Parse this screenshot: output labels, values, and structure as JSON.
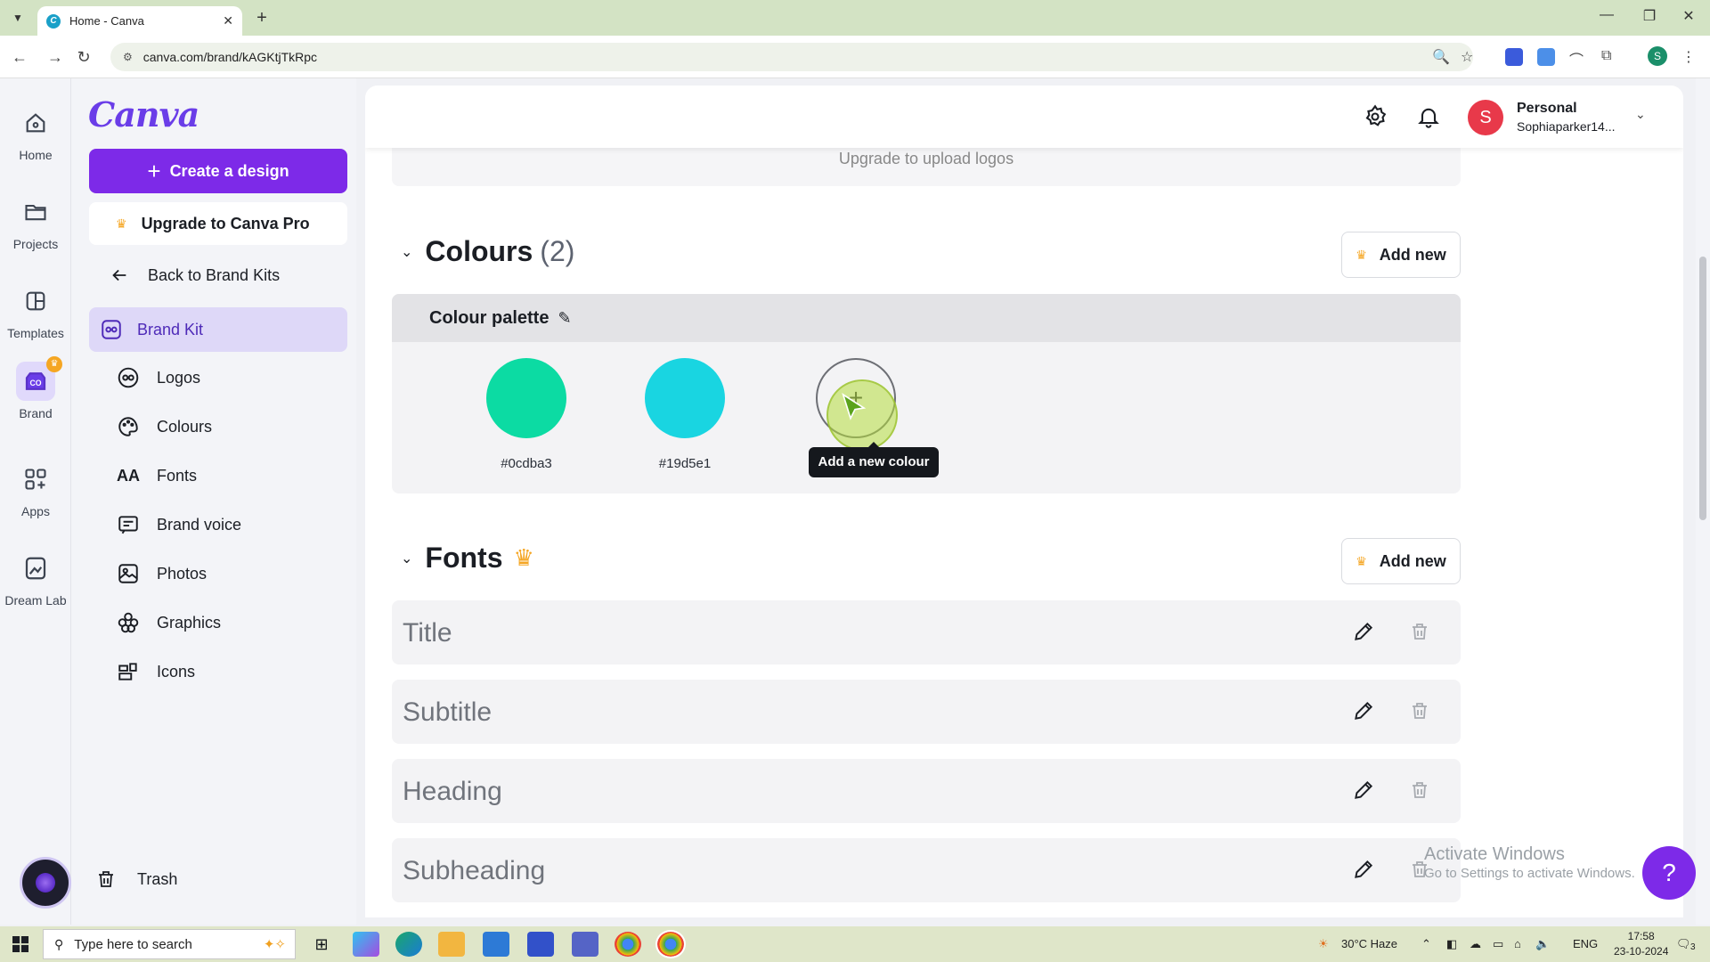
{
  "browser": {
    "tab_title": "Home - Canva",
    "url": "canva.com/brand/kAGKtjTkRpc",
    "profile_initial": "S"
  },
  "rail": {
    "items": [
      {
        "label": "Home",
        "icon": "home-icon"
      },
      {
        "label": "Projects",
        "icon": "folder-icon"
      },
      {
        "label": "Templates",
        "icon": "templates-icon"
      },
      {
        "label": "Brand",
        "icon": "brand-icon"
      },
      {
        "label": "Apps",
        "icon": "apps-icon"
      },
      {
        "label": "Dream Lab",
        "icon": "dream-lab-icon"
      }
    ]
  },
  "sidebar": {
    "logo": "Canva",
    "create_label": "Create a design",
    "upgrade_label": "Upgrade to Canva Pro",
    "back_label": "Back to Brand Kits",
    "brand_kit_label": "Brand Kit",
    "sub_items": [
      {
        "label": "Logos",
        "icon": "logo-icon"
      },
      {
        "label": "Colours",
        "icon": "palette-icon"
      },
      {
        "label": "Fonts",
        "icon": "font-icon"
      },
      {
        "label": "Brand voice",
        "icon": "brand-voice-icon"
      },
      {
        "label": "Photos",
        "icon": "photo-icon"
      },
      {
        "label": "Graphics",
        "icon": "graphics-icon"
      },
      {
        "label": "Icons",
        "icon": "icons-icon"
      }
    ],
    "trash_label": "Trash"
  },
  "topbar": {
    "avatar_initial": "S",
    "account_name": "Personal",
    "account_email": "Sophiaparker14..."
  },
  "logos_section": {
    "upload_text": "Upgrade to upload logos"
  },
  "colours_section": {
    "title": "Colours",
    "count": "(2)",
    "add_new_label": "Add new",
    "palette_name": "Colour palette",
    "swatches": [
      {
        "hex": "#0cdba3",
        "label": "#0cdba3"
      },
      {
        "hex": "#19d5e1",
        "label": "#19d5e1"
      }
    ],
    "add_tooltip": "Add a new colour"
  },
  "fonts_section": {
    "title": "Fonts",
    "add_new_label": "Add new",
    "rows": [
      "Title",
      "Subtitle",
      "Heading",
      "Subheading"
    ]
  },
  "overlay": {
    "activate_title": "Activate Windows",
    "activate_sub": "Go to Settings to activate Windows.",
    "help_label": "?"
  },
  "taskbar": {
    "search_placeholder": "Type here to search",
    "weather": "30°C  Haze",
    "lang": "ENG",
    "time": "17:58",
    "date": "23-10-2024",
    "notifications": "3"
  },
  "colors": {
    "brand_purple": "#7d2ae8",
    "active_bg": "#ded8f8"
  }
}
